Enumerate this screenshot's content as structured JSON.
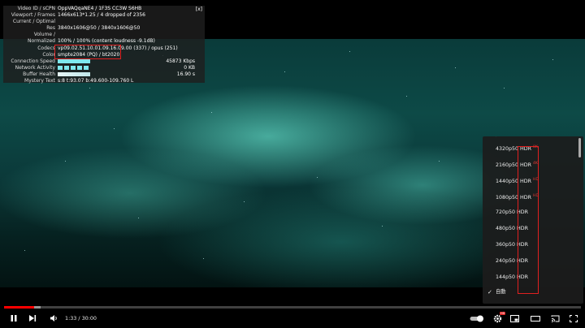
{
  "stats": {
    "close_label": "[x]",
    "rows": [
      {
        "key": "Video ID / sCPN",
        "value": "OppVAQqaNE4 / 1F3S CC3W S6HB"
      },
      {
        "key": "Viewport / Frames",
        "value": "1466x613*1.25 / 4 dropped of 2356"
      },
      {
        "key": "Current / Optimal",
        "value": ""
      },
      {
        "key": "Res",
        "value": "3840x1606@50 / 3840x1606@50"
      },
      {
        "key": "Volume /",
        "value": ""
      },
      {
        "key": "Normalized",
        "value": "100% / 100% (content loudness -9.1dB)"
      },
      {
        "key": "Codecs",
        "value": "vp09.02.51.10.01.09.16.09.00 (337) / opus (251)"
      },
      {
        "key": "Color",
        "value": "smpte2084 (PQ) / bt2020"
      },
      {
        "key": "Connection Speed",
        "value": "",
        "right": "45873 Kbps"
      },
      {
        "key": "Network Activity",
        "value": "",
        "right": "0 KB"
      },
      {
        "key": "Buffer Health",
        "value": "",
        "right": "16.90 s"
      },
      {
        "key": "Mystery Text",
        "value": "s:8 t:93.07 b:49.600-109.760 L"
      }
    ]
  },
  "quality_menu": {
    "items": [
      {
        "label": "4320p50 HDR",
        "badge": "8K"
      },
      {
        "label": "2160p50 HDR",
        "badge": "4K"
      },
      {
        "label": "1440p50 HDR",
        "badge": "HD"
      },
      {
        "label": "1080p50 HDR",
        "badge": "HD"
      },
      {
        "label": "720p50 HDR",
        "badge": ""
      },
      {
        "label": "480p50 HDR",
        "badge": ""
      },
      {
        "label": "360p50 HDR",
        "badge": ""
      },
      {
        "label": "240p50 HDR",
        "badge": ""
      },
      {
        "label": "144p50 HDR",
        "badge": ""
      },
      {
        "label": "自動",
        "badge": "",
        "selected": true
      }
    ]
  },
  "player": {
    "time_display": "1:33 / 30:00",
    "progress_played": 0.052,
    "progress_loaded": 0.063,
    "settings_badge": "HD",
    "accent_color": "#ff0000"
  }
}
